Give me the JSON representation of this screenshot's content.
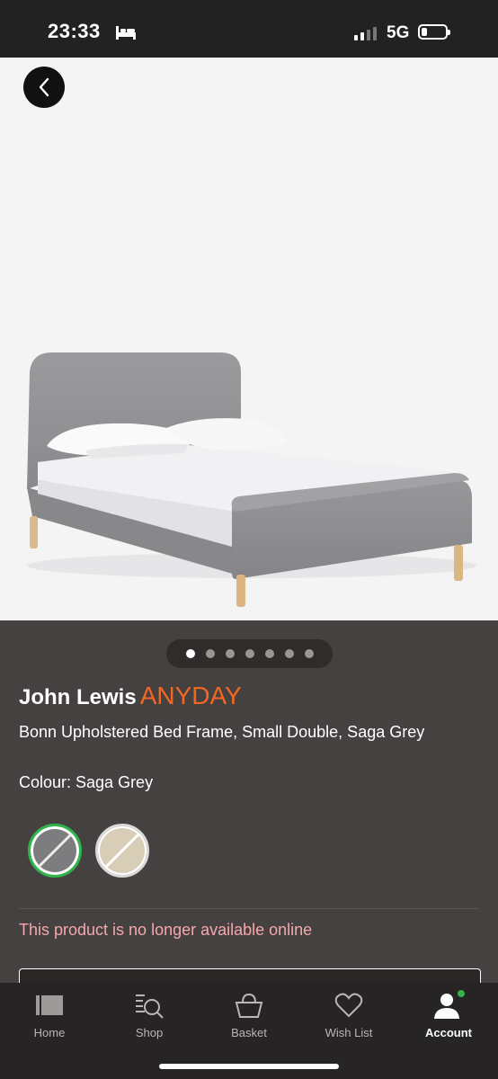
{
  "status_bar": {
    "time": "23:33",
    "network": "5G",
    "battery_level": 0.15
  },
  "product": {
    "brand": "John Lewis",
    "sub_brand": "ANYDAY",
    "name": "Bonn Upholstered Bed Frame, Small Double, Saga Grey",
    "colour_label": "Colour: Saga Grey",
    "availability": "This product is no longer available online",
    "swatches": [
      {
        "name": "Saga Grey",
        "color": "#7d7d80",
        "selected": true
      },
      {
        "name": "Natural",
        "color": "#d8cdb6",
        "selected": false
      }
    ]
  },
  "gallery": {
    "image_count": 7,
    "current_index": 1
  },
  "colors": {
    "accent": "#f26722",
    "selected_ring": "#2fb54a",
    "alert": "#f4a8ad",
    "background": "#454140"
  },
  "tabs": [
    {
      "label": "Home",
      "icon": "home-icon"
    },
    {
      "label": "Shop",
      "icon": "shop-search-icon"
    },
    {
      "label": "Basket",
      "icon": "basket-icon"
    },
    {
      "label": "Wish List",
      "icon": "heart-icon"
    },
    {
      "label": "Account",
      "icon": "account-icon",
      "active": true
    }
  ]
}
